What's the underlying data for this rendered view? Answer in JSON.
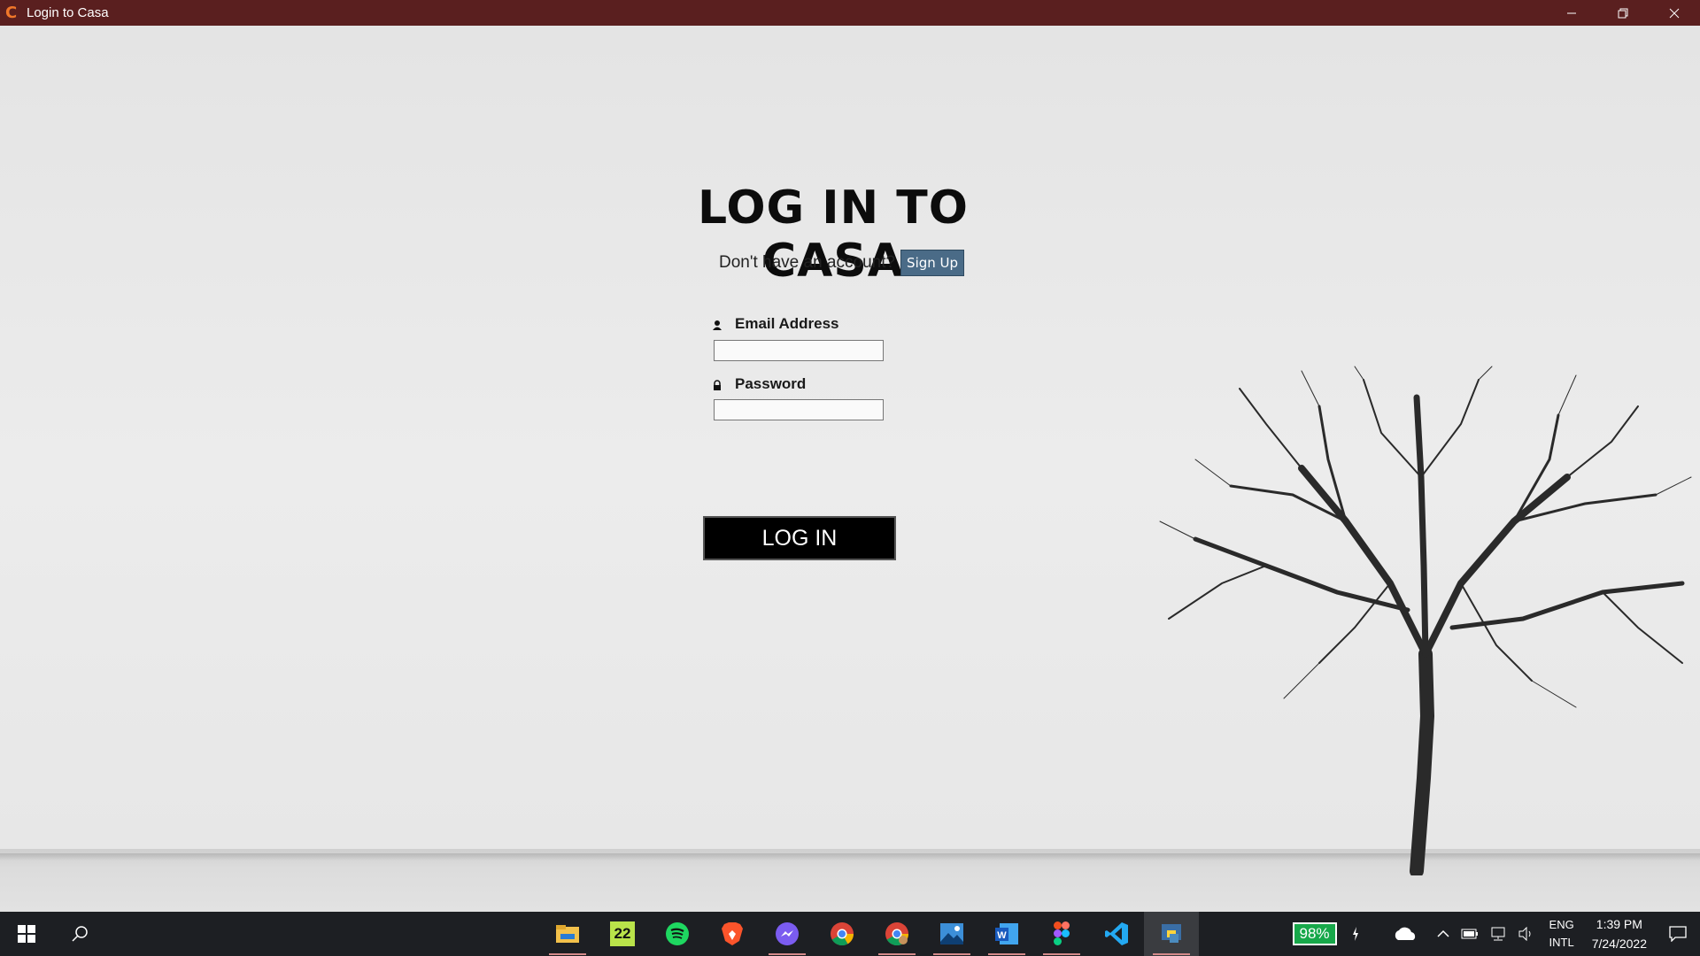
{
  "window": {
    "title": "Login to Casa",
    "app_icon_glyph": "C",
    "controls": [
      "minimize-icon",
      "restore-icon",
      "close-icon"
    ]
  },
  "login": {
    "heading": "LOG IN TO CASA",
    "signup_prompt": "Don't have an account?",
    "signup_button": "Sign Up",
    "email_label": "Email Address",
    "email_value": "",
    "password_label": "Password",
    "password_value": "",
    "login_button": "LOG IN"
  },
  "taskbar": {
    "apps": [
      {
        "name": "file-explorer-icon",
        "running": true
      },
      {
        "name": "twenty-two-app-icon",
        "label": "22",
        "running": false
      },
      {
        "name": "spotify-icon",
        "running": false
      },
      {
        "name": "brave-icon",
        "running": false
      },
      {
        "name": "messenger-icon",
        "running": true
      },
      {
        "name": "chrome-icon",
        "running": false
      },
      {
        "name": "chrome-profile-icon",
        "running": true
      },
      {
        "name": "photos-icon",
        "running": true
      },
      {
        "name": "word-icon",
        "running": true
      },
      {
        "name": "figma-icon",
        "running": true
      },
      {
        "name": "vscode-icon",
        "running": false
      },
      {
        "name": "python-icon",
        "running": true,
        "active": true
      }
    ],
    "battery_percent": "98%",
    "language": "ENG",
    "layout": "INTL",
    "time": "1:39 PM",
    "date": "7/24/2022"
  },
  "colors": {
    "titlebar": "#5a1f1f",
    "signup_button": "#4a6b87",
    "login_button": "#000000",
    "battery_badge": "#17a84a",
    "taskbar": "#1d1f23"
  }
}
